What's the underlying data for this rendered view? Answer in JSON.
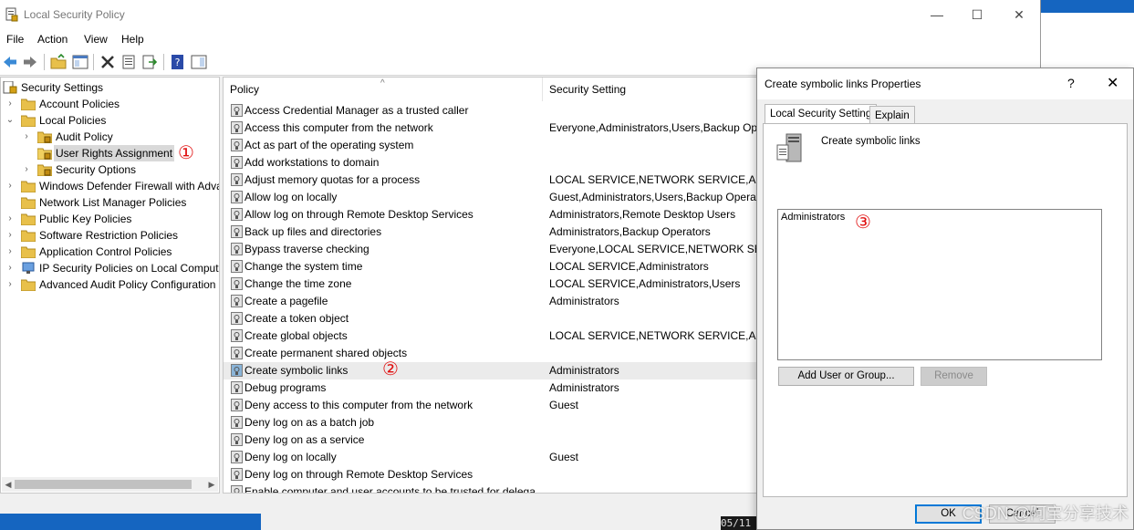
{
  "window": {
    "title": "Local Security Policy",
    "minimize": "—",
    "maximize": "☐",
    "close": "✕"
  },
  "menu": [
    "File",
    "Action",
    "View",
    "Help"
  ],
  "tree": [
    {
      "label": "Security Settings",
      "expander": "",
      "depth": 0
    },
    {
      "label": "Account Policies",
      "expander": "›",
      "depth": 1
    },
    {
      "label": "Local Policies",
      "expander": "⌄",
      "depth": 1
    },
    {
      "label": "Audit Policy",
      "expander": "›",
      "depth": 2
    },
    {
      "label": "User Rights Assignment",
      "expander": "",
      "depth": 2,
      "selected": true
    },
    {
      "label": "Security Options",
      "expander": "›",
      "depth": 2
    },
    {
      "label": "Windows Defender Firewall with Adva",
      "expander": "›",
      "depth": 1
    },
    {
      "label": "Network List Manager Policies",
      "expander": "",
      "depth": 1
    },
    {
      "label": "Public Key Policies",
      "expander": "›",
      "depth": 1
    },
    {
      "label": "Software Restriction Policies",
      "expander": "›",
      "depth": 1
    },
    {
      "label": "Application Control Policies",
      "expander": "›",
      "depth": 1
    },
    {
      "label": "IP Security Policies on Local Compute",
      "expander": "›",
      "depth": 1
    },
    {
      "label": "Advanced Audit Policy Configuration",
      "expander": "›",
      "depth": 1
    }
  ],
  "list": {
    "columns": [
      "Policy",
      "Security Setting"
    ],
    "sort_indicator": "^",
    "rows": [
      {
        "policy": "Access Credential Manager as a trusted caller",
        "setting": ""
      },
      {
        "policy": "Access this computer from the network",
        "setting": "Everyone,Administrators,Users,Backup Oper"
      },
      {
        "policy": "Act as part of the operating system",
        "setting": ""
      },
      {
        "policy": "Add workstations to domain",
        "setting": ""
      },
      {
        "policy": "Adjust memory quotas for a process",
        "setting": "LOCAL SERVICE,NETWORK SERVICE,Admini"
      },
      {
        "policy": "Allow log on locally",
        "setting": "Guest,Administrators,Users,Backup Operato"
      },
      {
        "policy": "Allow log on through Remote Desktop Services",
        "setting": "Administrators,Remote Desktop Users"
      },
      {
        "policy": "Back up files and directories",
        "setting": "Administrators,Backup Operators"
      },
      {
        "policy": "Bypass traverse checking",
        "setting": "Everyone,LOCAL SERVICE,NETWORK SERVIC"
      },
      {
        "policy": "Change the system time",
        "setting": "LOCAL SERVICE,Administrators"
      },
      {
        "policy": "Change the time zone",
        "setting": "LOCAL SERVICE,Administrators,Users"
      },
      {
        "policy": "Create a pagefile",
        "setting": "Administrators"
      },
      {
        "policy": "Create a token object",
        "setting": ""
      },
      {
        "policy": "Create global objects",
        "setting": "LOCAL SERVICE,NETWORK SERVICE,Admini"
      },
      {
        "policy": "Create permanent shared objects",
        "setting": ""
      },
      {
        "policy": "Create symbolic links",
        "setting": "Administrators",
        "selected": true
      },
      {
        "policy": "Debug programs",
        "setting": "Administrators"
      },
      {
        "policy": "Deny access to this computer from the network",
        "setting": "Guest"
      },
      {
        "policy": "Deny log on as a batch job",
        "setting": ""
      },
      {
        "policy": "Deny log on as a service",
        "setting": ""
      },
      {
        "policy": "Deny log on locally",
        "setting": "Guest"
      },
      {
        "policy": "Deny log on through Remote Desktop Services",
        "setting": ""
      },
      {
        "policy": "Enable computer and user accounts to be trusted for delega",
        "setting": ""
      }
    ]
  },
  "dialog": {
    "title": "Create symbolic links Properties",
    "help": "?",
    "close": "✕",
    "tabs": [
      "Local Security Setting",
      "Explain"
    ],
    "policy_name": "Create symbolic links",
    "members": [
      "Administrators"
    ],
    "add_button": "Add User or Group...",
    "remove_button": "Remove",
    "ok_button": "OK",
    "cancel_button": "Cancel"
  },
  "markers": [
    "①",
    "②",
    "③"
  ],
  "taskbar_clock": "05/11",
  "watermark": "CSDN @阿宝分享技术",
  "colors": {
    "accent": "#0078d7",
    "marker": "#e01010",
    "selection": "#d9d9d9"
  }
}
